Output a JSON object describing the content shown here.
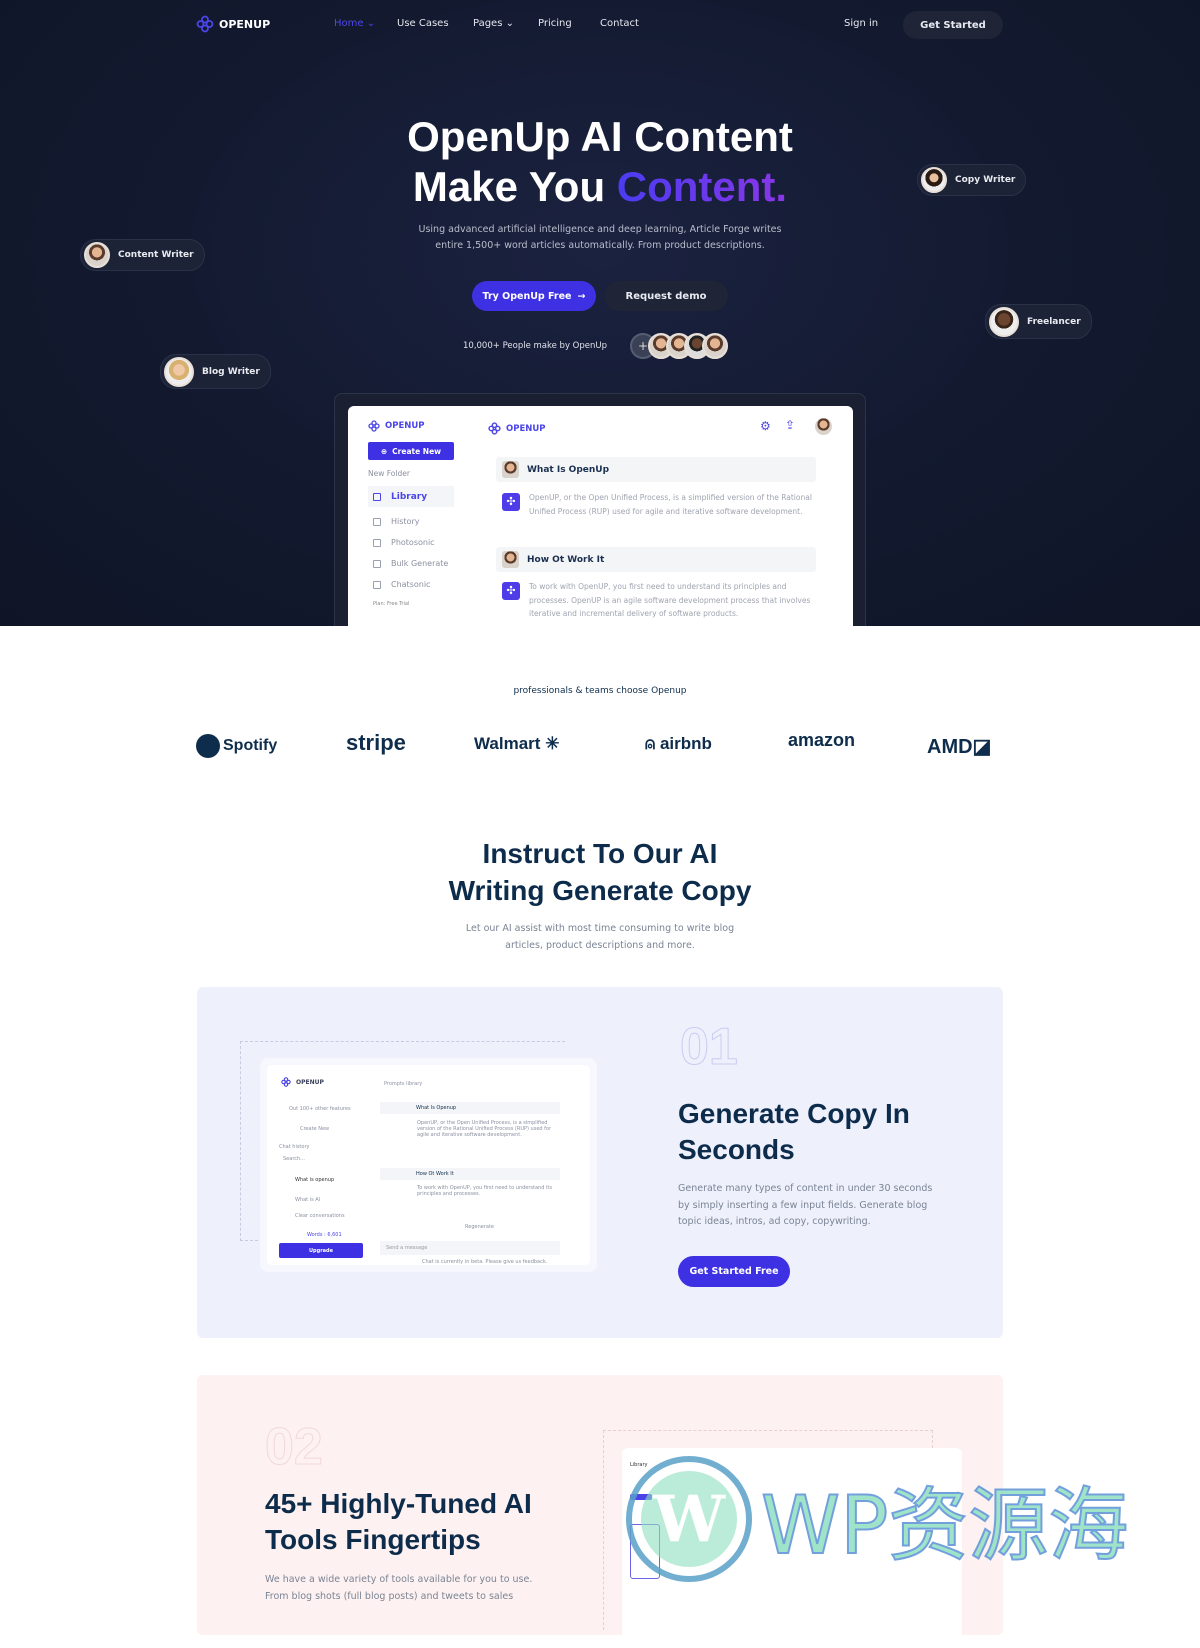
{
  "nav": {
    "brand": "OPENUP",
    "links": [
      {
        "label": "Home",
        "active": true,
        "has_dropdown": true
      },
      {
        "label": "Use Cases"
      },
      {
        "label": "Pages",
        "has_dropdown": true
      },
      {
        "label": "Pricing"
      },
      {
        "label": "Contact"
      }
    ],
    "sign_in": "Sign in",
    "get_started": "Get Started"
  },
  "hero": {
    "title_line1": "OpenUp AI Content",
    "title_line2_plain": "Make You ",
    "title_line2_accent": "Content.",
    "subtitle_line1": "Using advanced artificial intelligence and deep learning, Article Forge writes",
    "subtitle_line2": "entire 1,500+ word articles automatically. From product descriptions.",
    "primary_button": "Try OpenUp Free",
    "secondary_button": "Request demo",
    "social_proof": "10,000+ People make by OpenUp",
    "avatar_plus": "+",
    "pills": [
      "Content Writer",
      "Copy Writer",
      "Freelancer",
      "Blog Writer"
    ]
  },
  "app_mock": {
    "brand": "OPENUP",
    "create_new": "Create New",
    "folder_label": "New Folder",
    "menu": [
      "Library",
      "History",
      "Photosonic",
      "Bulk Generate",
      "Chatsonic"
    ],
    "plan": "Plan: Free Trial",
    "questions": [
      {
        "title": "What Is OpenUp",
        "answer": "OpenUP, or the Open Unified Process, is a simplified version of the Rational Unified Process (RUP) used for agile and iterative software development."
      },
      {
        "title": "How Ot Work It",
        "answer": "To work with OpenUP, you first need to understand its principles and processes. OpenUP is an agile software development process that involves iterative and incremental delivery of software products."
      }
    ]
  },
  "brands": {
    "label": "professionals & teams choose Openup",
    "logos": [
      "Spotify",
      "stripe",
      "Walmart",
      "airbnb",
      "amazon",
      "AMD"
    ]
  },
  "instruct": {
    "title_line1": "Instruct To Our AI",
    "title_line2": "Writing Generate Copy",
    "subtitle_line1": "Let our AI assist with most time consuming to write blog",
    "subtitle_line2": "articles, product descriptions and more."
  },
  "features": [
    {
      "number": "01",
      "title_line1": "Generate Copy In",
      "title_line2": "Seconds",
      "body_line1": "Generate many types of content in under 30 seconds",
      "body_line2": "by simply inserting a few input fields. Generate blog",
      "body_line3": "topic ideas, intros, ad copy, copywriting.",
      "button": "Get Started  Free",
      "mock": {
        "brand": "OPENUP",
        "search": "Prompts library",
        "features": "Out 100+ other features",
        "create": "Create New",
        "history_label": "Chat history",
        "search_ph": "Search...",
        "items": [
          "What is openup",
          "What is AI",
          "Clear conversations"
        ],
        "words": "Words : 6,601",
        "upgrade": "Upgrade",
        "q1": "What Is Openup",
        "a1": "OpenUP, or the Open Unified Process, is a simplified version of the Rational Unified Process (RUP) used for agile and iterative software development.",
        "q2": "How Ot Work It",
        "a2": "To work with OpenUP, you first need to understand its principles and processes.",
        "regenerate": "Regenerate",
        "message_ph": "Send a message",
        "footer": "Chat is currently in beta. Please give us feedback."
      }
    },
    {
      "number": "02",
      "title_line1": "45+ Highly-Tuned AI",
      "title_line2": "Tools Fingertips",
      "body_line1": "We have a wide variety of tools available for you to use.",
      "body_line2": "From blog shots (full blog posts) and tweets to sales",
      "mock": {
        "library": "Library"
      }
    }
  ],
  "watermark": "WP资源海",
  "colors": {
    "accent": "#3e31e4",
    "hero_bg": "#131a30",
    "heading": "#0d2c4b",
    "card1_bg": "#eef0fc",
    "card2_bg": "#fdf1f1"
  }
}
